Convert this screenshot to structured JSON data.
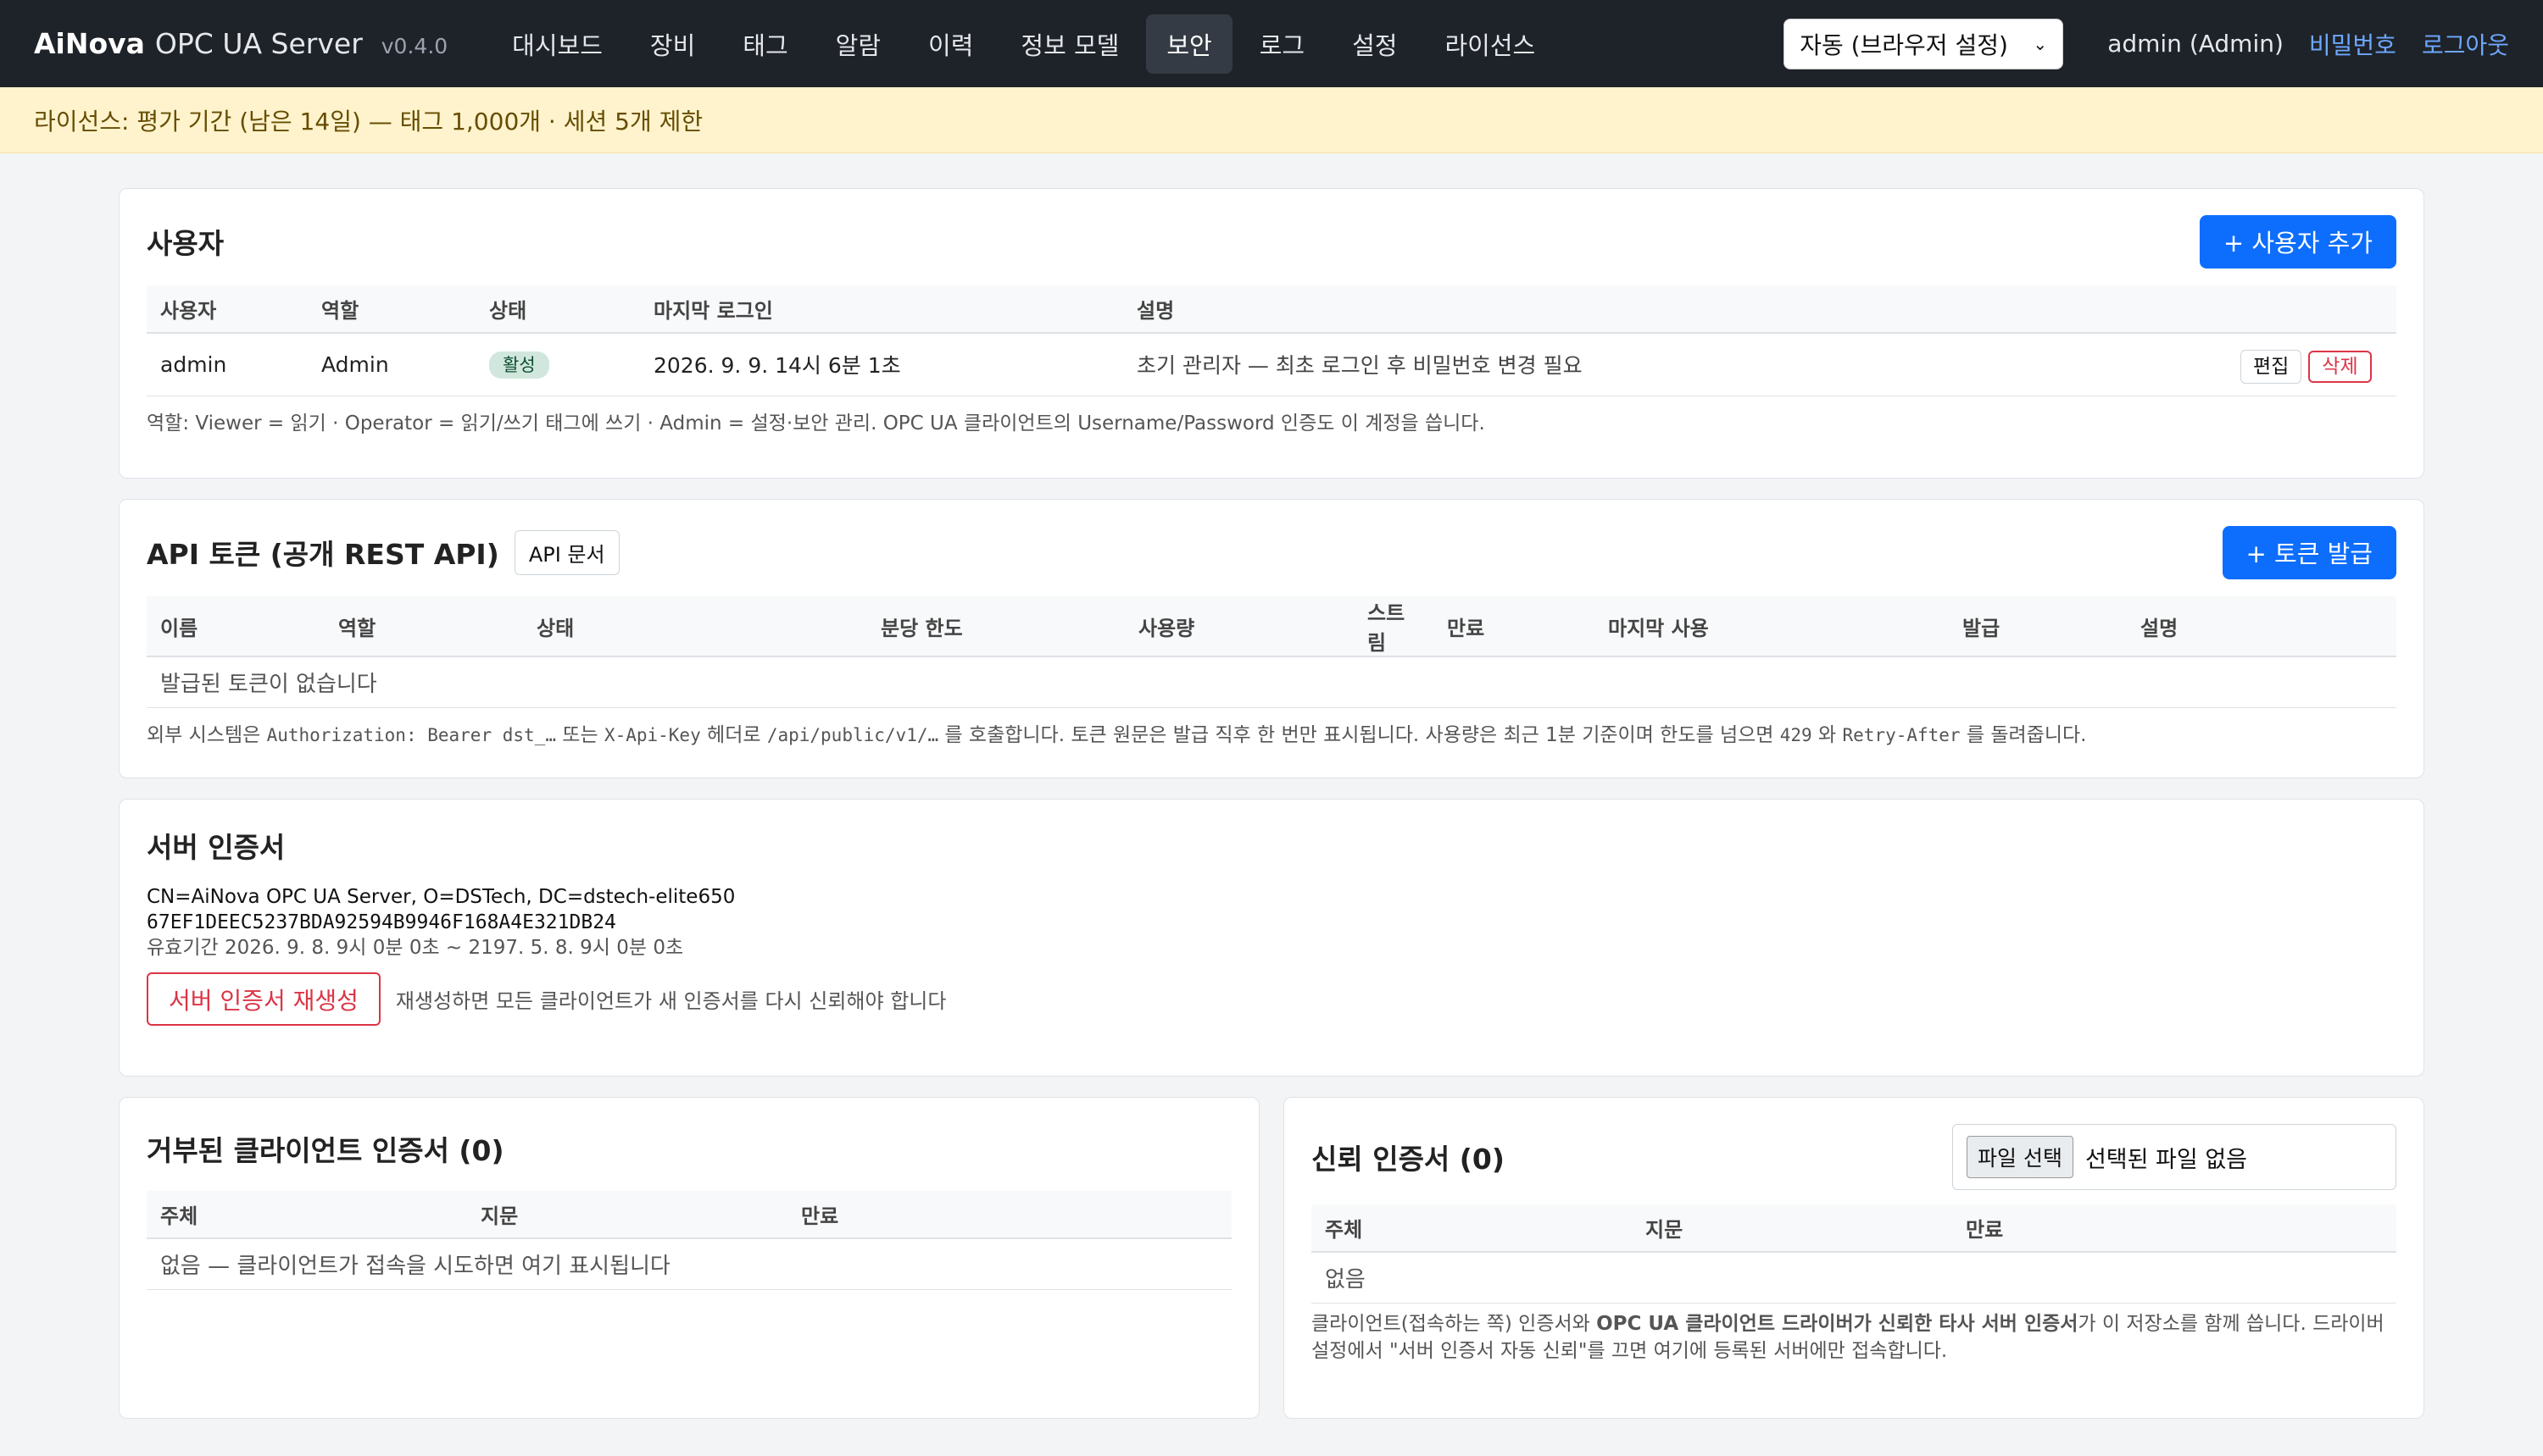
{
  "navbar": {
    "brand": "AiNova",
    "subtitle": "OPC UA Server",
    "version": "v0.4.0",
    "menu": [
      "대시보드",
      "장비",
      "태그",
      "알람",
      "이력",
      "정보 모델",
      "보안",
      "로그",
      "설정",
      "라이선스"
    ],
    "active_index": 6,
    "theme_select": "자동 (브라우저 설정)",
    "user": "admin (Admin)",
    "password_link": "비밀번호",
    "logout_link": "로그아웃"
  },
  "license": {
    "text": "라이선스: 평가 기간 (남은 14일) — 태그 1,000개 · 세션 5개 제한"
  },
  "users": {
    "title": "사용자",
    "add_button": "+ 사용자 추가",
    "columns": [
      "사용자",
      "역할",
      "상태",
      "마지막 로그인",
      "설명"
    ],
    "rows": [
      {
        "user": "admin",
        "role": "Admin",
        "status": "활성",
        "last_login": "2026. 9. 9. 14시 6분 1초",
        "description": "초기 관리자 — 최초 로그인 후 비밀번호 변경 필요",
        "edit": "편집",
        "delete": "삭제"
      }
    ],
    "note": "역할: Viewer = 읽기 · Operator = 읽기/쓰기 태그에 쓰기 · Admin = 설정·보안 관리. OPC UA 클라이언트의 Username/Password 인증도 이 계정을 씁니다."
  },
  "tokens": {
    "title": "API 토큰 (공개 REST API)",
    "docs_button": "API 문서",
    "issue_button": "+ 토큰 발급",
    "columns": [
      "이름",
      "역할",
      "상태",
      "분당 한도",
      "사용량",
      "스트림",
      "만료",
      "마지막 사용",
      "발급",
      "설명"
    ],
    "empty": "발급된 토큰이 없습니다",
    "note_parts": [
      "외부 시스템은 ",
      "Authorization: Bearer dst_…",
      " 또는 ",
      "X-Api-Key",
      " 헤더로 ",
      "/api/public/v1/…",
      " 를 호출합니다. 토큰 원문은 발급 직후 한 번만 표시됩니다. 사용량은 최근 1분 기준이며 한도를 넘으면 ",
      "429",
      " 와 ",
      "Retry-After",
      " 를 돌려줍니다."
    ]
  },
  "server_cert": {
    "title": "서버 인증서",
    "subject": "CN=AiNova OPC UA Server, O=DSTech, DC=dstech-elite650",
    "thumbprint": "67EF1DEEC5237BDA92594B9946F168A4E321DB24",
    "validity": "유효기간 2026. 9. 8. 9시 0분 0초 ~ 2197. 5. 8. 9시 0분 0초",
    "regen_button": "서버 인증서 재생성",
    "regen_note": "재생성하면 모든 클라이언트가 새 인증서를 다시 신뢰해야 합니다"
  },
  "rejected": {
    "title": "거부된 클라이언트 인증서 (0)",
    "columns": [
      "주체",
      "지문",
      "만료"
    ],
    "empty": "없음 — 클라이언트가 접속을 시도하면 여기 표시됩니다"
  },
  "trusted": {
    "title": "신뢰 인증서 (0)",
    "file_button": "파일 선택",
    "file_status": "선택된 파일 없음",
    "columns": [
      "주체",
      "지문",
      "만료"
    ],
    "empty": "없음",
    "note_parts": [
      "클라이언트(접속하는 쪽) 인증서와 ",
      "OPC UA 클라이언트 드라이버가 신뢰한 타사 서버 인증서",
      "가 이 저장소를 함께 씁니다. 드라이버 설정에서 \"서버 인증서 자동 신뢰\"를 끄면 여기에 등록된 서버에만 접속합니다."
    ]
  },
  "colors": {
    "navbar_bg": "#1e2329",
    "primary": "#0d6efd",
    "danger": "#dc3545",
    "license_bg": "#fff3cd",
    "link": "#6ea8fe"
  }
}
